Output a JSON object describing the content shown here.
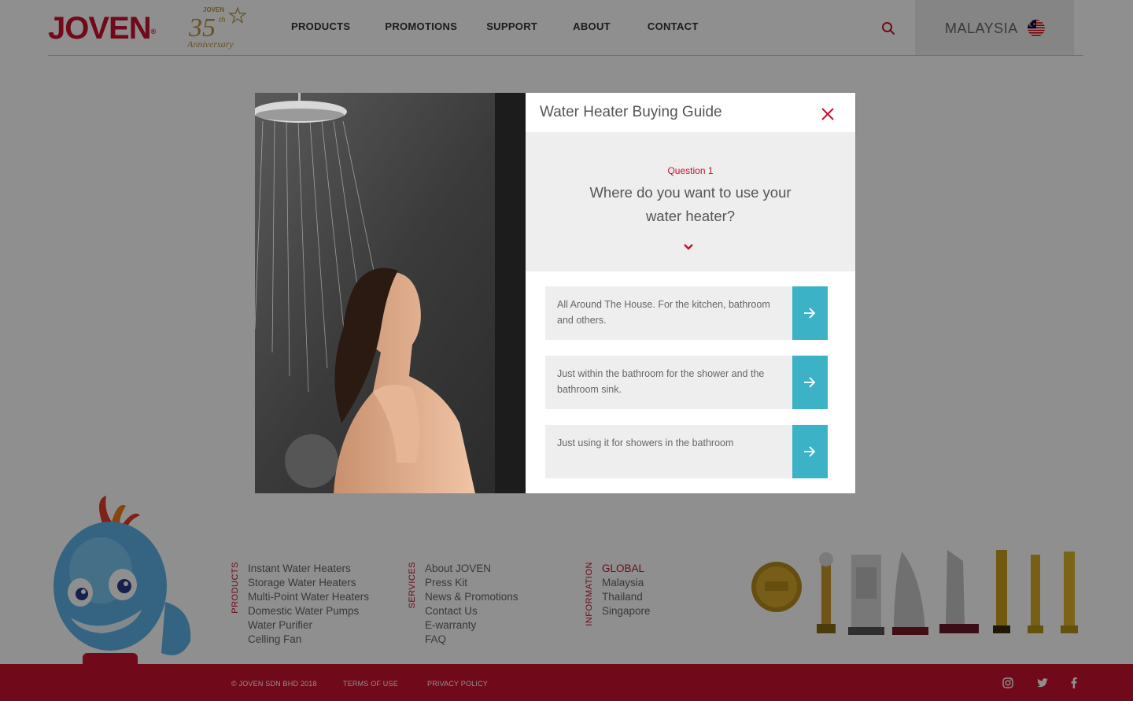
{
  "header": {
    "logo": "JOVEN",
    "logo_mark": "®",
    "anniversary": {
      "brand": "JOVEN",
      "number": "35",
      "suffix": "th",
      "word": "Anniversary"
    },
    "nav": [
      "PRODUCTS",
      "PROMOTIONS",
      "SUPPORT",
      "ABOUT",
      "CONTACT"
    ],
    "country": "MALAYSIA"
  },
  "modal": {
    "title": "Water Heater Buying Guide",
    "question_label": "Question 1",
    "question_text": "Where do you want to use your water heater?",
    "answers": [
      "All Around The House. For the kitchen, bathroom and others.",
      "Just within the bathroom for the shower and the bathroom sink.",
      "Just using it for showers in the bathroom"
    ]
  },
  "footer": {
    "products": {
      "label": "PRODUCTS",
      "items": [
        "Instant Water Heaters",
        "Storage Water Heaters",
        "Multi-Point Water Heaters",
        "Domestic Water Pumps",
        "Water Purifier",
        "Celling Fan"
      ]
    },
    "services": {
      "label": "SERVICES",
      "items": [
        "About JOVEN",
        "Press Kit",
        "News & Promotions",
        "Contact Us",
        "E-warranty",
        "FAQ"
      ]
    },
    "information": {
      "label": "INFORMATION",
      "items": [
        "GLOBAL",
        "Malaysia",
        "Thailand",
        "Singapore"
      ]
    },
    "copyright": "© JOVEN SDN BHD 2018",
    "terms": "TERMS  OF USE",
    "privacy": "PRIVACY POLICY",
    "social": [
      "instagram-icon",
      "twitter-icon",
      "facebook-icon"
    ]
  },
  "colors": {
    "brand_red": "#c8102e",
    "accent_teal": "#3bb2c6",
    "panel_grey": "#eeeeee"
  }
}
